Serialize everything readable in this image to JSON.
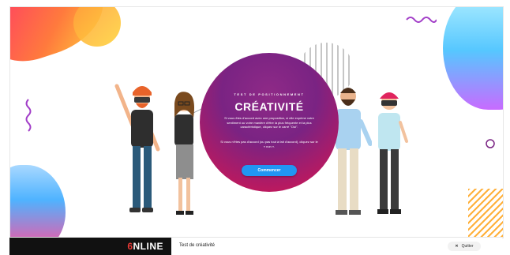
{
  "main": {
    "eyebrow": "TEST DE POSITIONNEMENT",
    "title": "CRÉATIVITÉ",
    "instruction_agree": "Si vous êtes d'accord avec une proposition, si elle exprime votre sentiment ou votre manière d'être la plus fréquente et la plus caractéristique, cliquez sur le carré \"Oui\".",
    "instruction_disagree": "Si vous n'êtes pas d'accord (ou pas tout à fait d'accord), cliquez sur le « non ».",
    "start_button": "Commencer"
  },
  "footer": {
    "logo_first": "6",
    "logo_rest": "NLINE",
    "test_label": "Test de créativité",
    "quit_label": "Quitter",
    "quit_icon": "close-icon"
  },
  "colors": {
    "circle_primary": "#7a2383",
    "circle_secondary": "#d81b60",
    "button": "#2196f3",
    "logo_bg": "#111111"
  }
}
